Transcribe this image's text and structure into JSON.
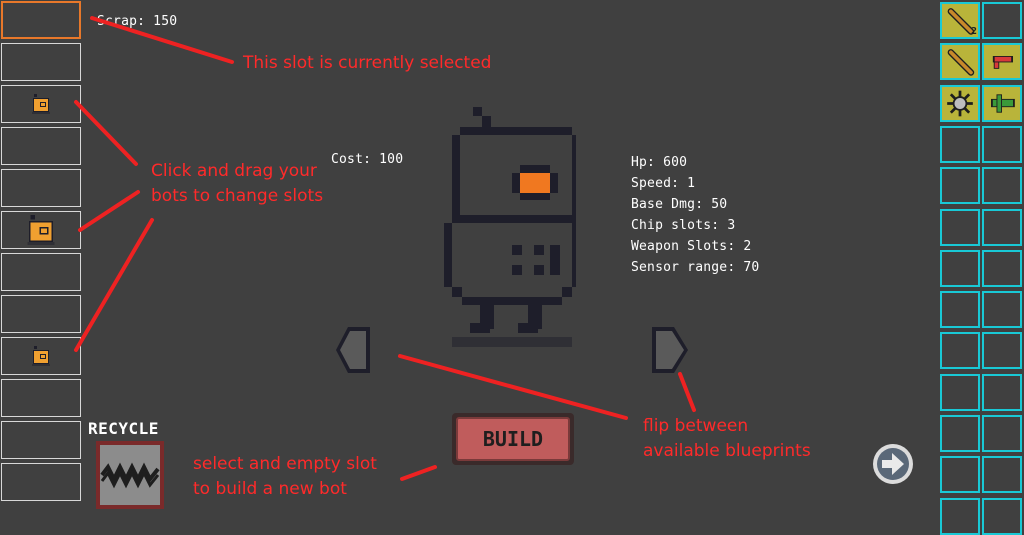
{
  "hud": {
    "scrap_label": "Scrap: 150"
  },
  "slots": [
    {
      "state": "selected",
      "bot": null
    },
    {
      "state": "empty",
      "bot": null
    },
    {
      "state": "occupied",
      "bot": "small-bot"
    },
    {
      "state": "empty",
      "bot": null
    },
    {
      "state": "empty",
      "bot": null
    },
    {
      "state": "occupied",
      "bot": "large-bot"
    },
    {
      "state": "empty",
      "bot": null
    },
    {
      "state": "empty",
      "bot": null
    },
    {
      "state": "occupied",
      "bot": "small-bot"
    },
    {
      "state": "empty",
      "bot": null
    },
    {
      "state": "empty",
      "bot": null
    },
    {
      "state": "empty",
      "bot": null
    }
  ],
  "blueprint": {
    "cost_label": "Cost: 100",
    "stats": [
      "Hp: 600",
      "Speed: 1",
      "Base Dmg: 50",
      "Chip slots: 3",
      "Weapon Slots: 2",
      "Sensor range: 70"
    ]
  },
  "buttons": {
    "build_label": "BUILD",
    "recycle_label": "RECYCLE",
    "prev_icon": "left-arrow-icon",
    "next_icon": "right-arrow-icon",
    "continue_icon": "circle-arrow-right-icon"
  },
  "inventory": {
    "columns": 2,
    "rows": 13,
    "items": [
      {
        "row": 0,
        "col": 0,
        "icon": "bat-icon",
        "count": "2"
      },
      {
        "row": 1,
        "col": 0,
        "icon": "bat-icon",
        "count": ""
      },
      {
        "row": 1,
        "col": 1,
        "icon": "pistol-icon",
        "count": ""
      },
      {
        "row": 2,
        "col": 0,
        "icon": "spiked-ball-icon",
        "count": ""
      },
      {
        "row": 2,
        "col": 1,
        "icon": "cannon-icon",
        "count": ""
      }
    ]
  },
  "annotations": {
    "selected_slot": "This slot is currently selected",
    "drag_bots": [
      "Click and drag your",
      "bots to change slots"
    ],
    "flip_blueprints": [
      "flip between",
      "available blueprints"
    ],
    "build_new": [
      "select and empty slot",
      "to build a new bot"
    ]
  },
  "colors": {
    "background": "#404040",
    "annotation": "#ff2a2a",
    "slot_selected": "#e8782a",
    "bot_orange": "#f0a030",
    "inventory_border": "#19c9d6",
    "inventory_item_bg": "#b9b43a",
    "build_button": "#c05c5c"
  }
}
